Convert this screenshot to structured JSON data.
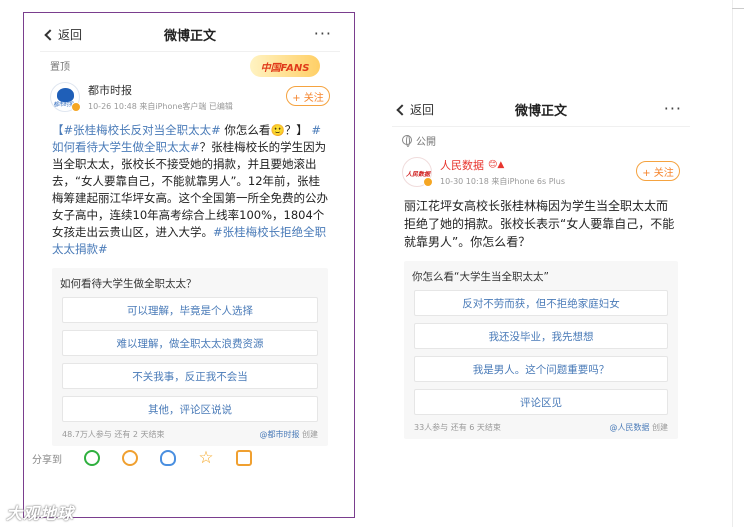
{
  "left_phone": {
    "nav": {
      "back": "返回",
      "title": "微博正文",
      "more": "···"
    },
    "pinned": "置顶",
    "fans_badge": "中国FANS",
    "author": {
      "name": "都市时报",
      "time": "10-26 10:48  来自iPhone客户端  已编辑",
      "avatar_text": "都市时报"
    },
    "follow": "+ 关注",
    "post": {
      "hashtag1": "【#张桂梅校长反对当全职太太#",
      "q1": " 你怎么看",
      "emoji": "🙂",
      "q2": "？】",
      "hashtag2": "#如何看待大学生做全职太太#",
      "body": "？张桂梅校长的学生因为当全职太太，张校长不接受她的捐款，并且要她滚出去，“女人要靠自己，不能就靠男人”。12年前，张桂梅筹建起丽江华坪女高。这个全国第一所全免费的公办女子高中，连续10年高考综合上线率100%，1804个女孩走出云贵山区，进入大学。",
      "hashtag3": "#张桂梅校长拒绝全职太太捐款#"
    },
    "poll": {
      "question": "如何看待大学生做全职太太？",
      "options": [
        "可以理解，毕竟是个人选择",
        "难以理解，做全职太太浪费资源",
        "不关我事，反正我不会当",
        "其他，评论区说说"
      ],
      "footer_left": "48.7万人参与  还有 2 天结束",
      "footer_src": "@都市时报",
      "footer_suffix": " 创建"
    },
    "share": {
      "label": "分享到"
    }
  },
  "right_phone": {
    "nav": {
      "back": "返回",
      "title": "微博正文",
      "more": "···"
    },
    "visibility": "公開",
    "author": {
      "name": "人民数据",
      "time": "10-30 10:18  来自iPhone 6s Plus",
      "avatar_text": "人民数据"
    },
    "follow": "+ 关注",
    "post": {
      "body": "丽江花坪女高校长张桂林梅因为学生当全职太太而拒绝了她的捐款。张校长表示“女人要靠自己，不能就靠男人”。你怎么看？"
    },
    "poll": {
      "question": "你怎么看“大学生当全职太太”",
      "options": [
        "反对不劳而获，但不拒绝家庭妇女",
        "我还没毕业，我先想想",
        "我是男人。这个问题重要吗？",
        "评论区见"
      ],
      "footer_left": "33人参与  还有 6 天结束",
      "footer_src": "@人民数据",
      "footer_suffix": " 创建"
    }
  },
  "watermark": "大观地球"
}
